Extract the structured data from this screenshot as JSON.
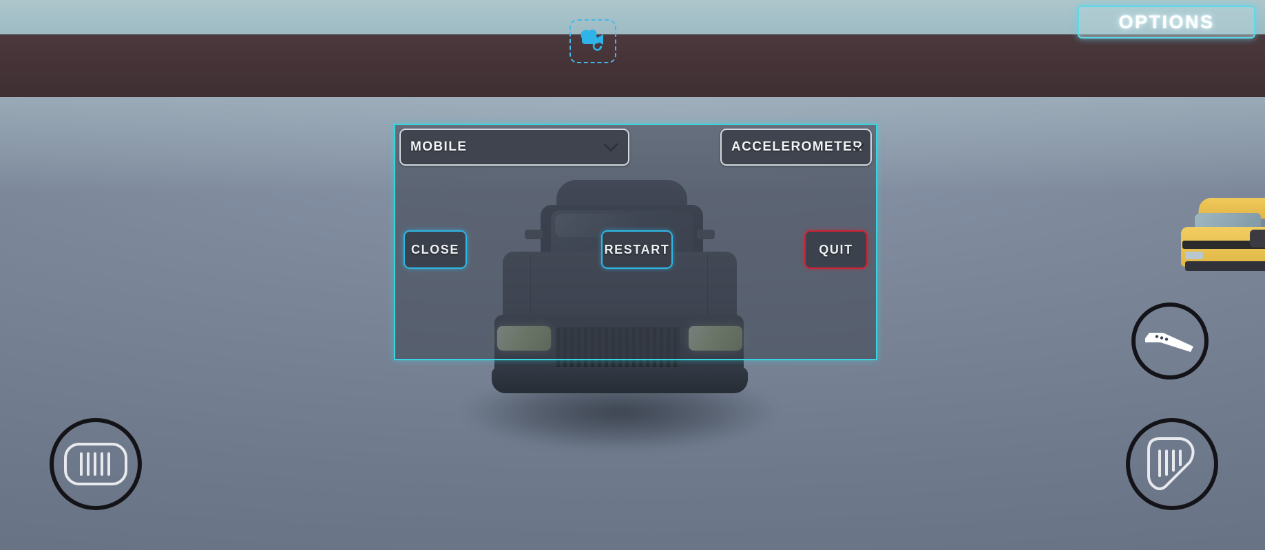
{
  "screen": {
    "title": "Car Parking / Driving Simulator — Pause Menu",
    "sky_color": "#a7c2c9",
    "wall_color": "#443438",
    "ground_color": "#78849a",
    "accent_cyan": "#38d6e0",
    "accent_red": "#cf2233"
  },
  "hud": {
    "options_button": {
      "label": "OPTIONS",
      "icon": "options-button"
    },
    "record_chip": {
      "icon": "video-camera-replay-icon",
      "color": "#2eb4e8"
    },
    "brake_pedal": {
      "icon": "brake-pedal-icon"
    },
    "gas_pedal": {
      "icon": "accelerator-pedal-icon"
    },
    "handbrake": {
      "icon": "handbrake-lever-icon"
    }
  },
  "panel": {
    "platform_select": {
      "value": "MOBILE",
      "chevron": "chevron-down-icon"
    },
    "control_select": {
      "value": "ACCELEROMETER",
      "chevron": "chevron-down-icon"
    },
    "buttons": {
      "close": "CLOSE",
      "restart": "RESTART",
      "quit": "QUIT"
    }
  }
}
